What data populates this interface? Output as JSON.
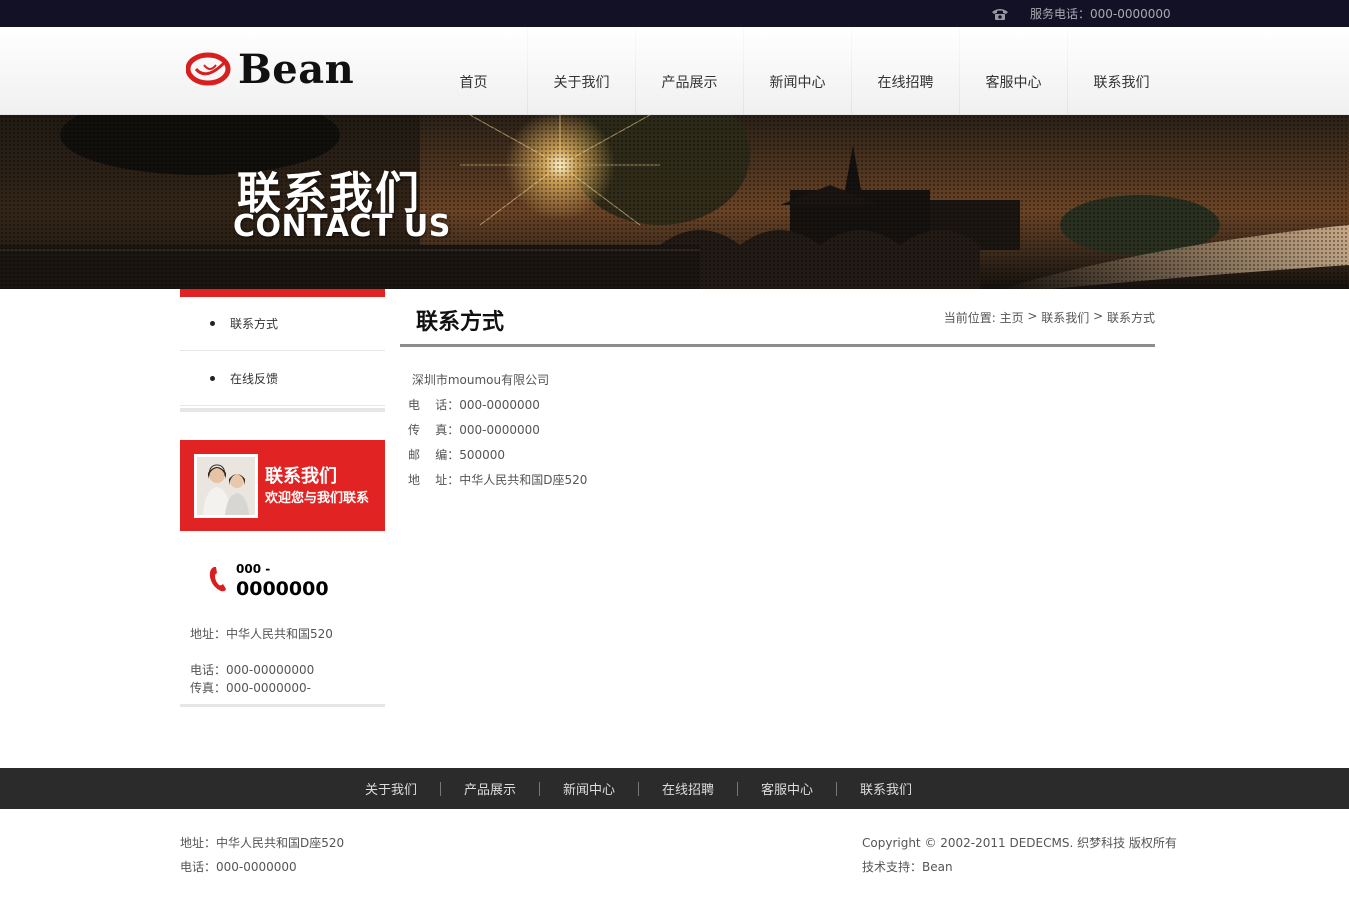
{
  "topbar": {
    "phone_text": "服务电话：000-0000000",
    "icon": "telephone-icon"
  },
  "header": {
    "logo_text": "Bean",
    "nav": [
      "首页",
      "关于我们",
      "产品展示",
      "新闻中心",
      "在线招聘",
      "客服中心",
      "联系我们"
    ]
  },
  "banner": {
    "title_cn": "联系我们",
    "title_en": "CONTACT US"
  },
  "sidebar": {
    "menu": [
      "联系方式",
      "在线反馈"
    ],
    "contact_box": {
      "title": "联系我们",
      "subtitle": "欢迎您与我们联系"
    },
    "hotline": {
      "small": "000 -",
      "big": "0000000"
    },
    "address": "地址：中华人民共和国520",
    "tel": "电话：000-00000000",
    "fax": "传真：000-0000000-"
  },
  "main": {
    "title": "联系方式",
    "breadcrumb": {
      "prefix": "当前位置: ",
      "items": [
        "主页",
        "联系我们",
        "联系方式"
      ],
      "separator": " > "
    },
    "lines": [
      " 深圳市moumou有限公司",
      "电    话：000-0000000",
      "传    真：000-0000000",
      "邮    编：500000",
      "地    址：中华人民共和国D座520"
    ]
  },
  "footer": {
    "nav": [
      "关于我们",
      "产品展示",
      "新闻中心",
      "在线招聘",
      "客服中心",
      "联系我们"
    ],
    "address": "地址：中华人民共和国D座520",
    "tel": "电话：000-0000000",
    "copyright": "Copyright © 2002-2011 DEDECMS. 织梦科技 版权所有",
    "support": "技术支持：Bean"
  },
  "colors": {
    "accent": "#e22323",
    "topbar": "#131125",
    "footer": "#2b2b2b"
  }
}
